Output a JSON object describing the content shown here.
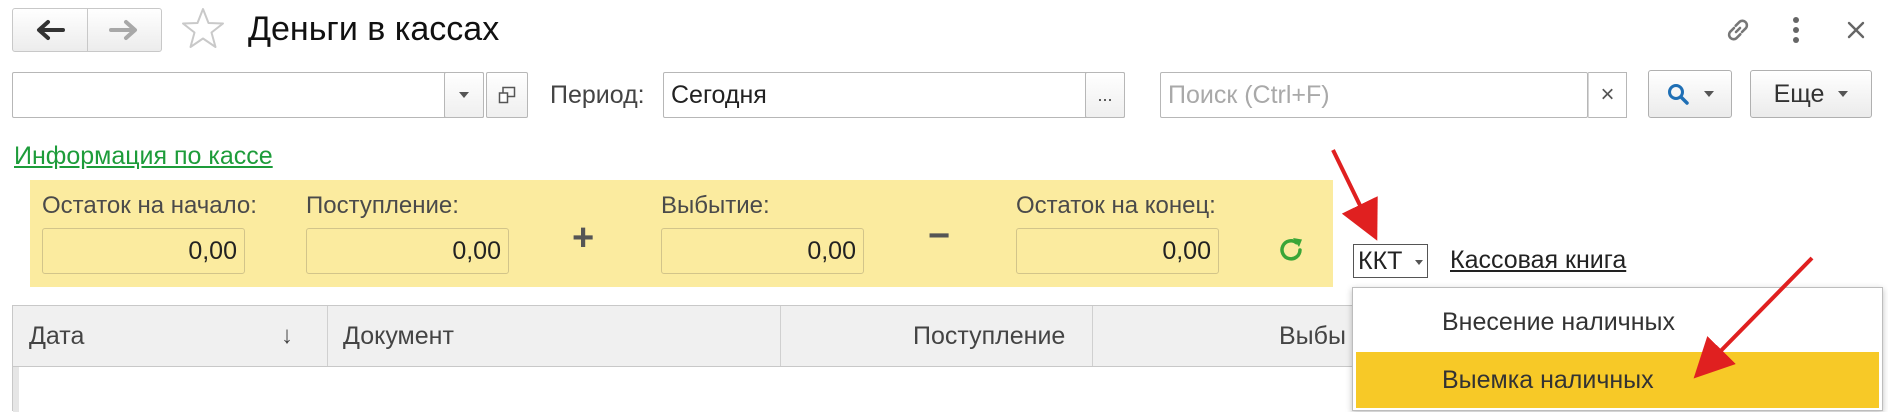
{
  "window": {
    "title": "Деньги в кассах",
    "back_icon": "arrow-left-icon",
    "forward_icon": "arrow-right-icon",
    "favorite_icon": "star-icon",
    "link_icon": "link-icon",
    "menu_icon": "more-vertical-icon",
    "close_icon": "close-icon"
  },
  "filters": {
    "cashbox_value": "",
    "period_label": "Период:",
    "period_value": "Сегодня",
    "period_button": "...",
    "search_placeholder": "Поиск (Ctrl+F)",
    "search_clear": "×",
    "more_button": "Еще"
  },
  "info_link": "Информация по кассе",
  "balances": {
    "start_label": "Остаток на начало:",
    "start_value": "0,00",
    "income_label": "Поступление:",
    "income_value": "0,00",
    "plus": "+",
    "outflow_label": "Выбытие:",
    "outflow_value": "0,00",
    "minus": "−",
    "end_label": "Остаток на конец:",
    "end_value": "0,00",
    "refresh_icon": "refresh-icon"
  },
  "kkt_button": "ККТ",
  "cash_book_link": "Кассовая книга",
  "table": {
    "columns": [
      "Дата",
      "Документ",
      "Поступление",
      "Выбы"
    ],
    "sort_indicator": "↓"
  },
  "kkt_menu": {
    "items": [
      "Внесение наличных",
      "Выемка наличных"
    ],
    "selected_index": 1
  },
  "colors": {
    "balance_panel": "#fbeb9f",
    "selected_menu_item": "#f7c927",
    "link_green": "#1d9c3a",
    "annotation_arrow": "#e02020"
  }
}
